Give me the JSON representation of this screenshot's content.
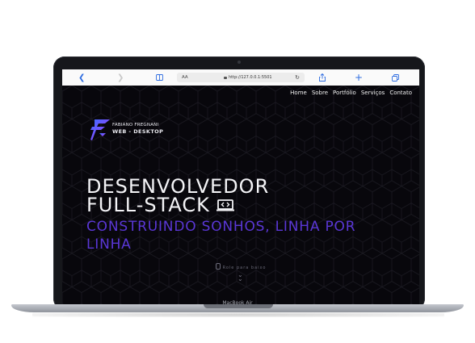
{
  "device": {
    "brand_label": "MacBook Air"
  },
  "browser": {
    "aa_label": "AA",
    "url": "http://127.0.0.1:5501",
    "icons": [
      "chevron-left-icon",
      "chevron-right-icon",
      "book-icon",
      "lock-icon",
      "reload-icon",
      "share-icon",
      "plus-icon",
      "tabs-icon"
    ]
  },
  "site": {
    "nav": {
      "items": [
        "Home",
        "Sobre",
        "Portfólio",
        "Serviços",
        "Contato"
      ]
    },
    "logo": {
      "line1": "FABIANO FREGNANI",
      "line2": "WEB - DESKTOP"
    },
    "hero": {
      "line1": "DESENVOLVEDOR",
      "line2": "FULL-STACK",
      "subtitle": "CONSTRUINDO SONHOS, LINHA POR LINHA"
    },
    "scroll_hint": "Role para baixo",
    "colors": {
      "background": "#08070c",
      "accent": "#5a37d6",
      "logo_gradient": [
        "#3a6cff",
        "#b13cff"
      ]
    }
  }
}
